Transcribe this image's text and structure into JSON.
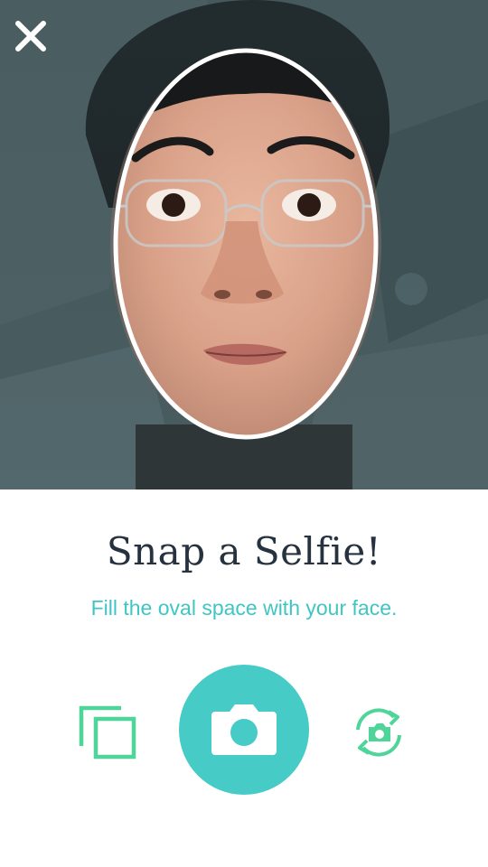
{
  "camera": {
    "close_icon": "close-icon"
  },
  "prompt": {
    "title": "Snap a Selfie!",
    "subtitle": "Fill the oval space with your face."
  },
  "controls": {
    "gallery_icon": "gallery-icon",
    "capture_icon": "camera-icon",
    "flip_icon": "flip-camera-icon"
  },
  "colors": {
    "accent": "#46cbc6",
    "icon_green": "#4fd49a",
    "title_text": "#26323f",
    "subtitle_text": "#3fc6c3"
  }
}
